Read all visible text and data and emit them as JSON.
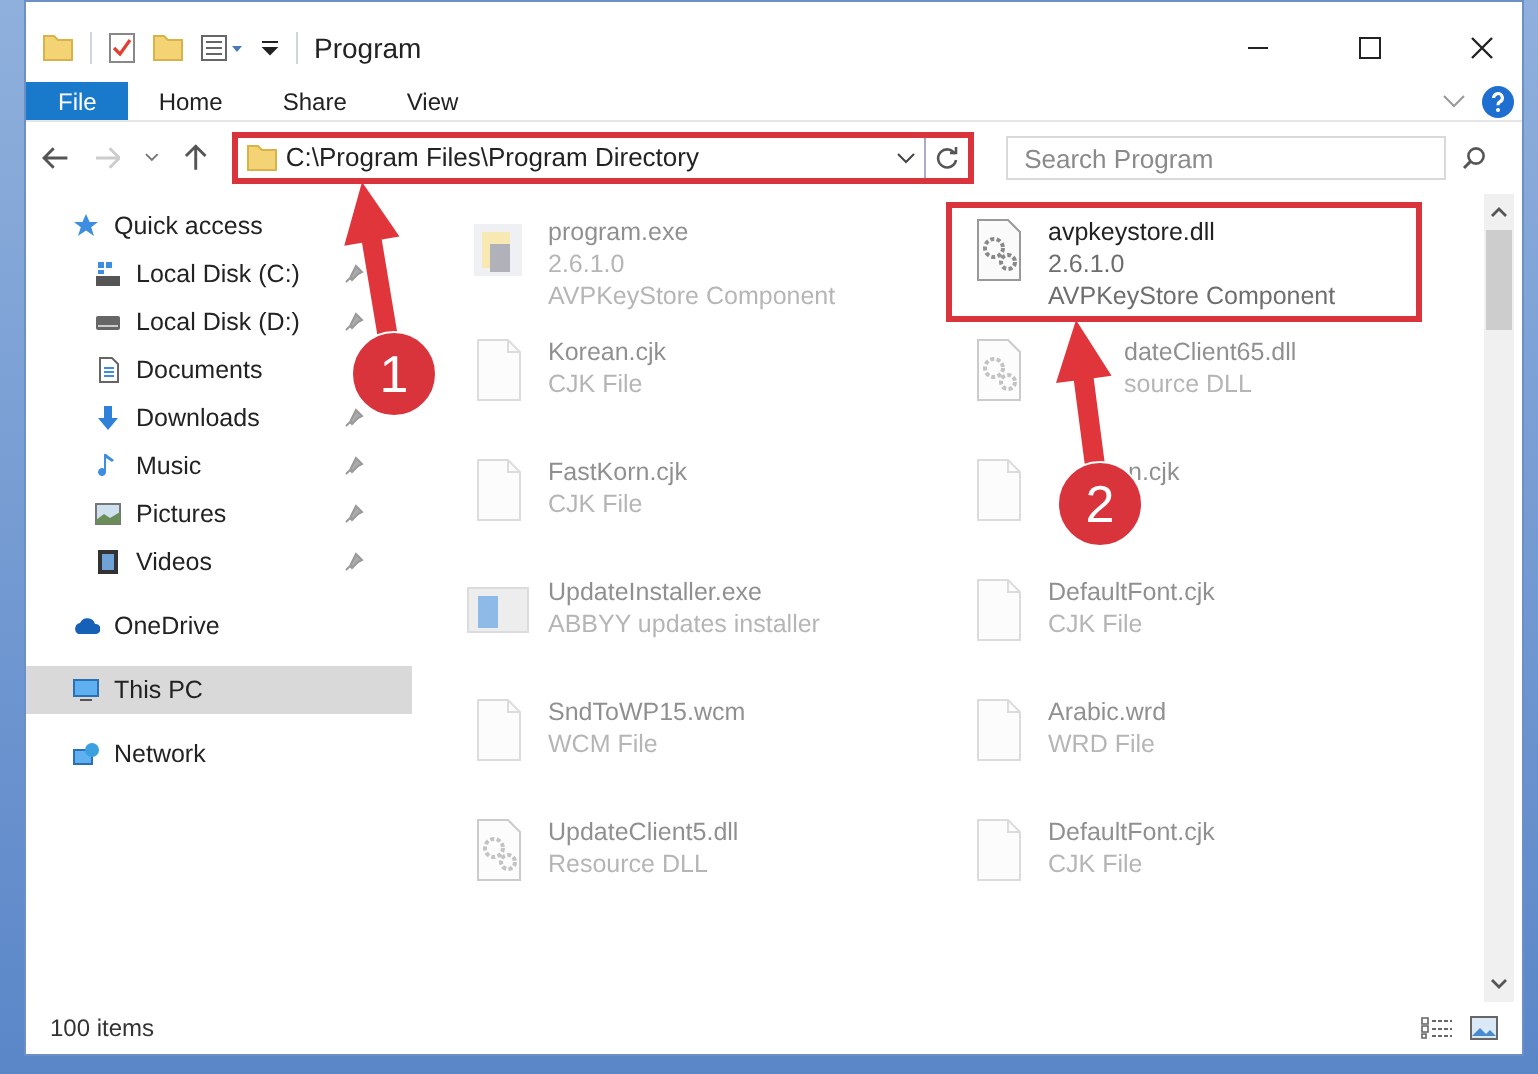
{
  "window": {
    "title": "Program"
  },
  "ribbon_tabs": [
    {
      "label": "File",
      "selected": true
    },
    {
      "label": "Home",
      "selected": false
    },
    {
      "label": "Share",
      "selected": false
    },
    {
      "label": "View",
      "selected": false
    }
  ],
  "address": {
    "path": "C:\\Program Files\\Program Directory",
    "highlighted": true
  },
  "search": {
    "placeholder": "Search Program"
  },
  "nav": [
    {
      "label": "Quick access",
      "selected": false,
      "children": [
        {
          "label": "Local Disk (C:)",
          "pinned": true,
          "selected": false
        },
        {
          "label": "Local Disk (D:)",
          "pinned": true,
          "selected": false
        },
        {
          "label": "Documents",
          "pinned": false,
          "selected": false
        },
        {
          "label": "Downloads",
          "pinned": true,
          "selected": false
        },
        {
          "label": "Music",
          "pinned": true,
          "selected": false
        },
        {
          "label": "Pictures",
          "pinned": true,
          "selected": false
        },
        {
          "label": "Videos",
          "pinned": true,
          "selected": false
        }
      ]
    },
    {
      "label": "OneDrive",
      "selected": false
    },
    {
      "label": "This PC",
      "selected": true
    },
    {
      "label": "Network",
      "selected": false
    }
  ],
  "files": [
    {
      "name": "program.exe",
      "lines": [
        "2.6.1.0",
        "AVPKeyStore Component"
      ],
      "faded": true,
      "highlighted": false
    },
    {
      "name": "avpkeystore.dll",
      "lines": [
        "2.6.1.0",
        "AVPKeyStore Component"
      ],
      "faded": false,
      "highlighted": true
    },
    {
      "name": "Korean.cjk",
      "lines": [
        "CJK File"
      ],
      "faded": true,
      "highlighted": false
    },
    {
      "name": "dateClient65.dll",
      "lines": [
        "source DLL"
      ],
      "faded": true,
      "highlighted": false
    },
    {
      "name": "FastKorn.cjk",
      "lines": [
        "CJK File"
      ],
      "faded": true,
      "highlighted": false
    },
    {
      "name": "n.cjk",
      "faded": true,
      "highlighted": false
    },
    {
      "name": "UpdateInstaller.exe",
      "lines": [
        "ABBYY updates installer"
      ],
      "faded": true,
      "highlighted": false
    },
    {
      "name": "DefaultFont.cjk",
      "lines": [
        "CJK File"
      ],
      "faded": true,
      "highlighted": false
    },
    {
      "name": "SndToWP15.wcm",
      "lines": [
        "WCM File"
      ],
      "faded": true,
      "highlighted": false
    },
    {
      "name": "Arabic.wrd",
      "lines": [
        "WRD File"
      ],
      "faded": true,
      "highlighted": false
    },
    {
      "name": "UpdateClient5.dll",
      "lines": [
        "Resource DLL"
      ],
      "faded": true,
      "highlighted": false
    },
    {
      "name": "DefaultFont.cjk",
      "lines": [
        "CJK File"
      ],
      "faded": true,
      "highlighted": false
    }
  ],
  "status_bar": {
    "count": "100 items"
  },
  "annotations": [
    {
      "number": "1"
    },
    {
      "number": "2"
    }
  ]
}
